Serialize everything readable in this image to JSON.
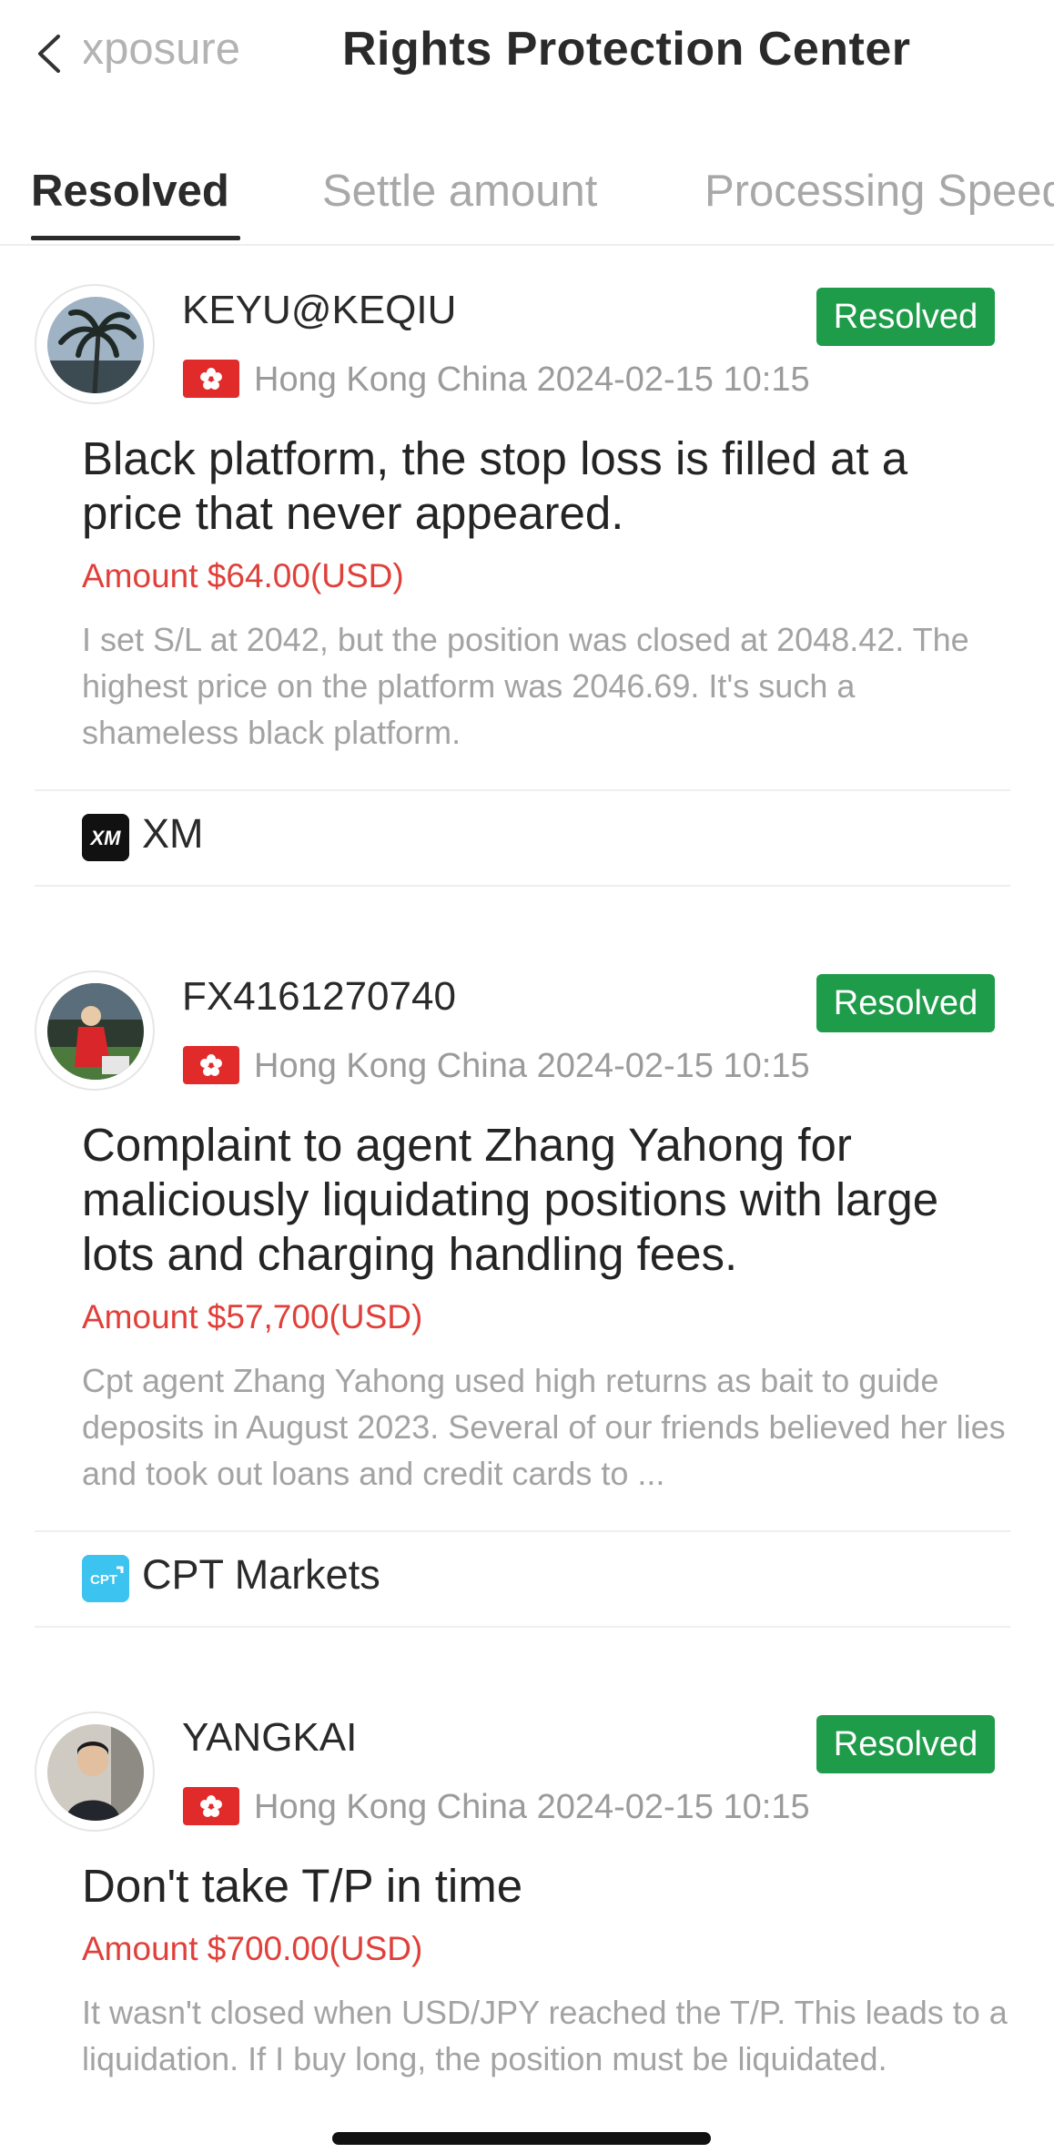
{
  "header": {
    "back_label": "Exposure",
    "title": "Rights Protection Center"
  },
  "tabs": [
    {
      "label": "Resolved",
      "active": true
    },
    {
      "label": "Settle amount",
      "active": false
    },
    {
      "label": "Processing Speed",
      "active": false
    }
  ],
  "colors": {
    "resolved_badge": "#1e9c4a",
    "amount_text": "#e0403a",
    "flag_red": "#e12a2a"
  },
  "complaints": [
    {
      "username": "KEYU@KEQIU",
      "status": "Resolved",
      "region": "Hong Kong China",
      "datetime": "2024-02-15 10:15",
      "headline": "Black platform, the stop loss is filled at a price that never appeared.",
      "amount": "Amount $64.00(USD)",
      "description": "I set S/L at 2042, but the position was closed at 2048.42. The highest price on the platform was 2046.69. It's such a shameless black platform.",
      "broker": "XM",
      "broker_logo_text": "XM"
    },
    {
      "username": "FX4161270740",
      "status": "Resolved",
      "region": "Hong Kong China",
      "datetime": "2024-02-15 10:15",
      "headline": "Complaint to agent Zhang Yahong for maliciously liquidating positions with large lots and charging handling fees.",
      "amount": "Amount $57,700(USD)",
      "description": "Cpt agent Zhang Yahong used high returns as bait to guide deposits in August 2023. Several of our friends believed her lies and took out loans and credit cards to ...",
      "broker": "CPT Markets",
      "broker_logo_text": "CPT"
    },
    {
      "username": "YANGKAI",
      "status": "Resolved",
      "region": "Hong Kong China",
      "datetime": "2024-02-15 10:15",
      "headline": "Don't take T/P in time",
      "amount": "Amount $700.00(USD)",
      "description": "It wasn't closed when USD/JPY reached the T/P. This leads to a liquidation. If I buy long, the position must be liquidated."
    }
  ]
}
